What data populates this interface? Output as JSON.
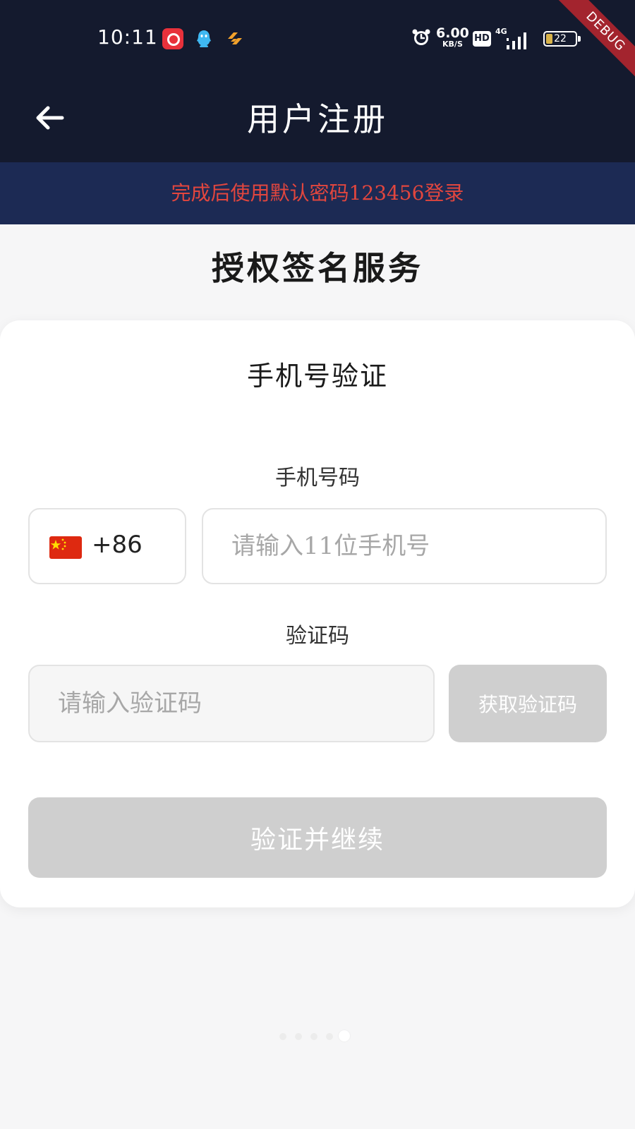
{
  "status_bar": {
    "time": "10:11",
    "network_speed_value": "6.00",
    "network_speed_unit": "KB/S",
    "hd_badge": "HD",
    "network_type": "4G",
    "battery_level": "22",
    "battery_fraction": 0.22,
    "debug_banner": "DEBUG",
    "icons": [
      "netease-music-icon",
      "qq-icon",
      "orange-app-icon",
      "alarm-icon",
      "signal-icon",
      "battery-icon"
    ]
  },
  "app_bar": {
    "title": "用户注册"
  },
  "notice": {
    "text": "完成后使用默认密码123456登录",
    "color": "#e2463e"
  },
  "page": {
    "heading": "授权签名服务"
  },
  "form": {
    "card_title": "手机号验证",
    "phone_label": "手机号码",
    "country_code": "+86",
    "phone_placeholder": "请输入11位手机号",
    "phone_value": "",
    "code_label": "验证码",
    "code_placeholder": "请输入验证码",
    "code_value": "",
    "get_code_button": "获取验证码",
    "submit_button": "验证并继续"
  },
  "colors": {
    "header_background": "#141a2e",
    "notice_background": "#1c2a54",
    "disabled_button": "#cfcfcf"
  }
}
